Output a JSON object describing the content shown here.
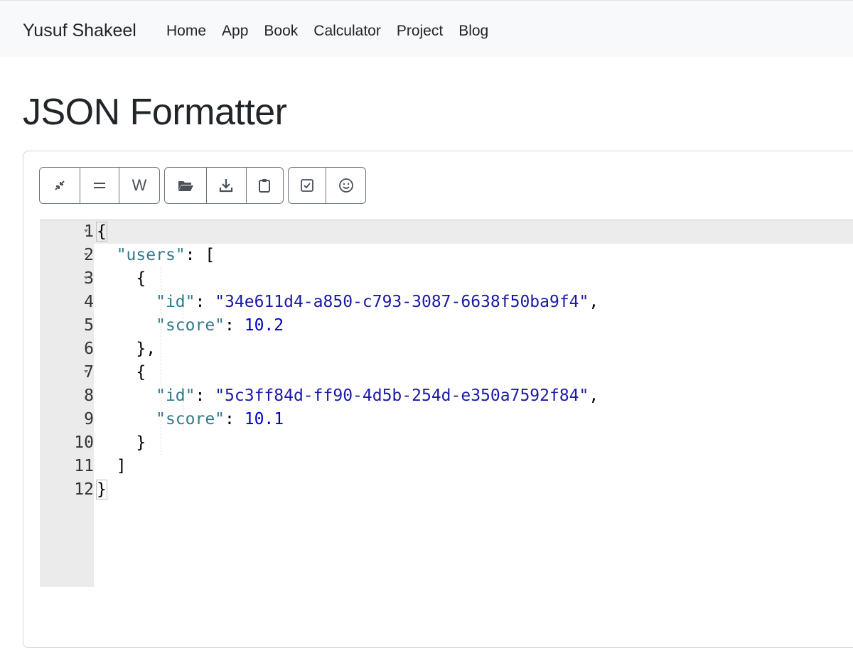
{
  "navbar": {
    "brand": "Yusuf Shakeel",
    "links": [
      "Home",
      "App",
      "Book",
      "Calculator",
      "Project",
      "Blog"
    ]
  },
  "page": {
    "title": "JSON Formatter"
  },
  "toolbar": {
    "group1": [
      {
        "icon": "compress-icon",
        "label": ""
      },
      {
        "icon": "format-icon",
        "label": ""
      },
      {
        "icon": "wrap-icon",
        "label": "W"
      }
    ],
    "group2": [
      {
        "icon": "folder-open-icon",
        "label": ""
      },
      {
        "icon": "download-icon",
        "label": ""
      },
      {
        "icon": "clipboard-icon",
        "label": ""
      }
    ],
    "group3": [
      {
        "icon": "validate-icon",
        "label": ""
      },
      {
        "icon": "smiley-icon",
        "label": ""
      }
    ]
  },
  "editor": {
    "line_numbers": [
      "1",
      "2",
      "3",
      "4",
      "5",
      "6",
      "7",
      "8",
      "9",
      "10",
      "11",
      "12"
    ],
    "lines": [
      "{",
      "  \"users\": [",
      "    {",
      "      \"id\": \"34e611d4-a850-c793-3087-6638f50ba9f4\",",
      "      \"score\": 10.2",
      "    },",
      "    {",
      "      \"id\": \"5c3ff84d-ff90-4d5b-254d-e350a7592f84\",",
      "      \"score\": 10.1",
      "    }",
      "  ]",
      "}"
    ],
    "tokens": {
      "users_key": "\"users\"",
      "id_key": "\"id\"",
      "score_key": "\"score\"",
      "id_1": "\"34e611d4-a850-c793-3087-6638f50ba9f4\"",
      "score_1": "10.2",
      "id_2": "\"5c3ff84d-ff90-4d5b-254d-e350a7592f84\"",
      "score_2": "10.1"
    },
    "colors": {
      "key": "#2f7a8c",
      "string": "#1a1aa6",
      "number": "#0000cd",
      "gutter": "#ebebeb"
    }
  }
}
